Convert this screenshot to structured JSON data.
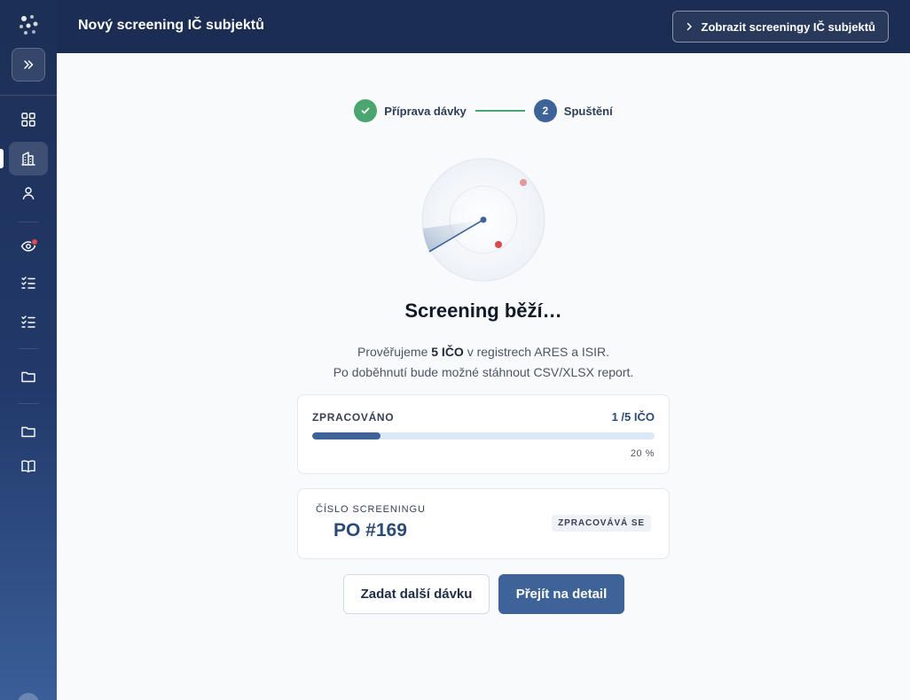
{
  "header": {
    "title": "Nový screening IČ subjektů",
    "view_button_label": "Zobrazit screeningy IČ subjektů"
  },
  "sidebar": {
    "items": [
      {
        "icon": "dashboard-icon"
      },
      {
        "icon": "buildings-icon",
        "active": true
      },
      {
        "icon": "user-icon"
      },
      {
        "icon": "eye-icon",
        "badge": true
      },
      {
        "icon": "checklist-icon"
      },
      {
        "icon": "checklist-icon"
      },
      {
        "icon": "folder-icon"
      },
      {
        "icon": "folder-icon"
      },
      {
        "icon": "book-icon"
      }
    ]
  },
  "stepper": {
    "steps": [
      {
        "number": "1",
        "label": "Příprava dávky",
        "state": "done"
      },
      {
        "number": "2",
        "label": "Spuštění",
        "state": "active"
      }
    ]
  },
  "status": {
    "title": "Screening běží…",
    "line1_prefix": "Prověřujeme ",
    "line1_count": "5 IČO",
    "line1_suffix": " v registrech ARES a ISIR.",
    "line2": "Po doběhnutí bude možné stáhnout CSV/XLSX report."
  },
  "progress": {
    "label": "ZPRACOVÁNO",
    "count_text": "1 /5 IČO",
    "processed": 1,
    "total": 5,
    "percent_text": "20 %",
    "percent": 20
  },
  "screening": {
    "label": "ČÍSLO SCREENINGU",
    "number": "PO #169",
    "status_badge": "ZPRACOVÁVÁ SE"
  },
  "actions": {
    "secondary_label": "Zadat další dávku",
    "primary_label": "Přejít na detail"
  },
  "colors": {
    "accent": "#3e6399",
    "success": "#4aa66e",
    "header_bg": "#1b2d52",
    "alert": "#e5484d"
  }
}
